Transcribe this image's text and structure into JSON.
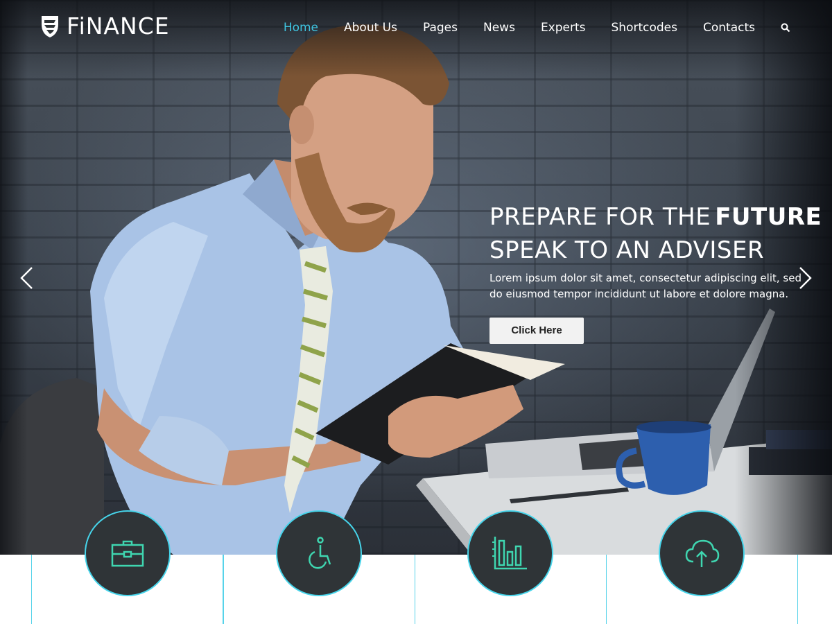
{
  "brand": {
    "name": "FiNANCE"
  },
  "nav": {
    "items": [
      {
        "label": "Home",
        "active": true
      },
      {
        "label": "About Us"
      },
      {
        "label": "Pages"
      },
      {
        "label": "News"
      },
      {
        "label": "Experts"
      },
      {
        "label": "Shortcodes"
      },
      {
        "label": "Contacts"
      }
    ],
    "search_icon": "search-icon"
  },
  "hero": {
    "headline_light": "PREPARE FOR THE",
    "headline_bold": "FUTURE",
    "headline_line2": "SPEAK TO AN ADVISER",
    "subtext": "Lorem ipsum dolor sit amet, consectetur adipiscing elit, sed do eiusmod tempor incididunt ut labore et dolore magna.",
    "cta_label": "Click Here",
    "prev_icon": "chevron-left-icon",
    "next_icon": "chevron-right-icon"
  },
  "features": [
    {
      "icon": "briefcase-icon"
    },
    {
      "icon": "accessibility-icon"
    },
    {
      "icon": "bar-chart-icon"
    },
    {
      "icon": "cloud-upload-icon"
    }
  ],
  "colors": {
    "accent": "#3fc4e0",
    "icon_bg": "#2f3437",
    "icon_stroke": "#3fd6b0"
  }
}
